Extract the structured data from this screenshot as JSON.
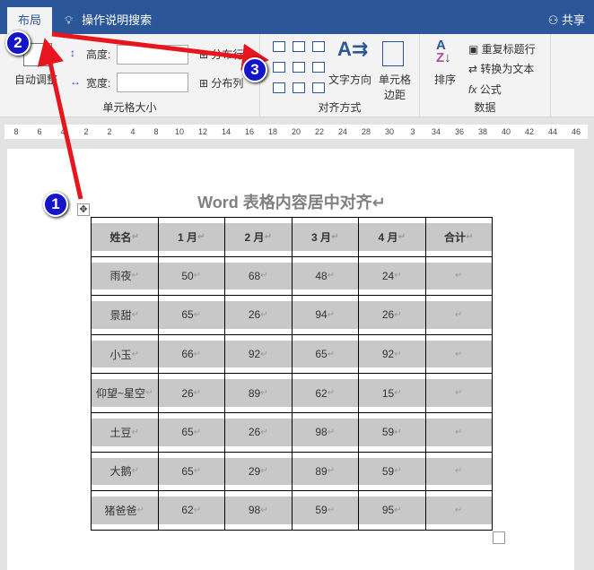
{
  "tabs": {
    "active": "布局",
    "search": "操作说明搜索",
    "share": "共享"
  },
  "ribbon": {
    "autofit": "自动调整",
    "height_label": "高度:",
    "width_label": "宽度:",
    "dist_rows": "分布行",
    "dist_cols": "分布列",
    "cell_size_group": "单元格大小",
    "text_direction": "文字方向",
    "cell_margins": "单元格边距",
    "align_group": "对齐方式",
    "sort": "排序",
    "repeat_header": "重复标题行",
    "convert_text": "转换为文本",
    "formula": "公式",
    "data_group": "数据"
  },
  "ruler": [
    "8",
    "6",
    "4",
    "2",
    "2",
    "4",
    "8",
    "10",
    "12",
    "14",
    "16",
    "18",
    "20",
    "22",
    "24",
    "28",
    "30",
    "3",
    "34",
    "36",
    "38",
    "40",
    "42",
    "44",
    "46"
  ],
  "document": {
    "title": "Word 表格内容居中对齐↵",
    "headers": [
      "姓名",
      "1 月",
      "2 月",
      "3 月",
      "4 月",
      "合计"
    ],
    "rows": [
      [
        "雨夜",
        "50",
        "68",
        "48",
        "24",
        ""
      ],
      [
        "景甜",
        "65",
        "26",
        "94",
        "26",
        ""
      ],
      [
        "小玉",
        "66",
        "92",
        "65",
        "92",
        ""
      ],
      [
        "仰望~星空",
        "26",
        "89",
        "62",
        "15",
        ""
      ],
      [
        "土豆",
        "65",
        "26",
        "98",
        "59",
        ""
      ],
      [
        "大鹅",
        "65",
        "29",
        "89",
        "59",
        ""
      ],
      [
        "猪爸爸",
        "62",
        "98",
        "59",
        "95",
        ""
      ]
    ]
  },
  "badges": [
    "1",
    "2",
    "3"
  ],
  "colors": {
    "titlebar": "#2b579a",
    "arrow": "#e8141e",
    "badge": "#1414c8",
    "cell": "#c8c8c8"
  }
}
